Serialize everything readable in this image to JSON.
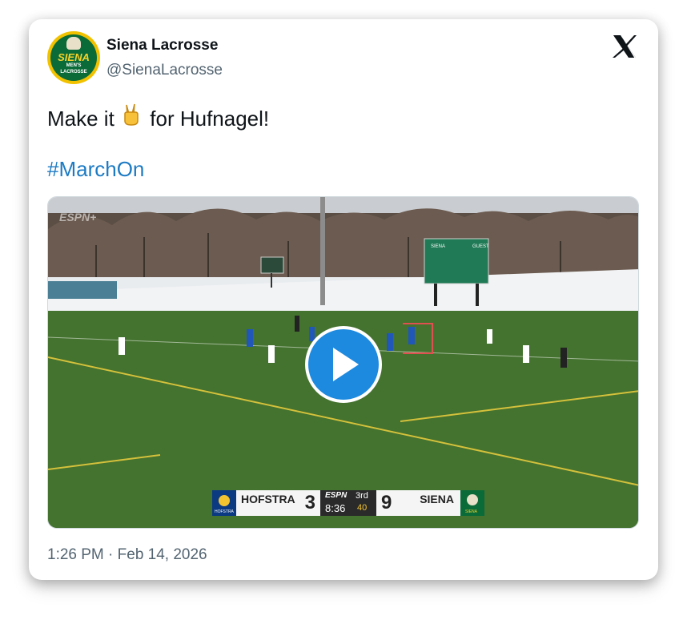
{
  "tweet": {
    "author_name": "Siena Lacrosse",
    "author_handle": "@SienaLacrosse",
    "text_before": "Make it",
    "emoji": "✌️",
    "text_after": "for Hufnagel!",
    "hashtag": "#MarchOn",
    "timestamp": "1:26 PM · Feb 14, 2026"
  },
  "avatar": {
    "line1": "SIENA",
    "line2": "MEN'S",
    "line3": "LACROSSE"
  },
  "video": {
    "watermark": "ESPN+",
    "scoreboard_sign": {
      "home_label": "SIENA",
      "guest_label": "GUEST"
    },
    "scorebug": {
      "home_team": "HOFSTRA",
      "home_score": "3",
      "network": "ESPN",
      "period": "3rd",
      "clock": "8:36",
      "shot_clock": "40",
      "away_score": "9",
      "away_team": "SIENA",
      "home_logo_text": "HOFSTRA",
      "away_logo_text": "SIENA"
    }
  },
  "icons": {
    "platform": "x-logo-icon",
    "play": "play-icon"
  },
  "colors": {
    "hashtag": "#1d7bc4",
    "play_button": "#1d8ae0",
    "siena_green": "#0b6b38",
    "siena_gold": "#f4d22a",
    "hofstra_blue": "#0b3a82"
  }
}
